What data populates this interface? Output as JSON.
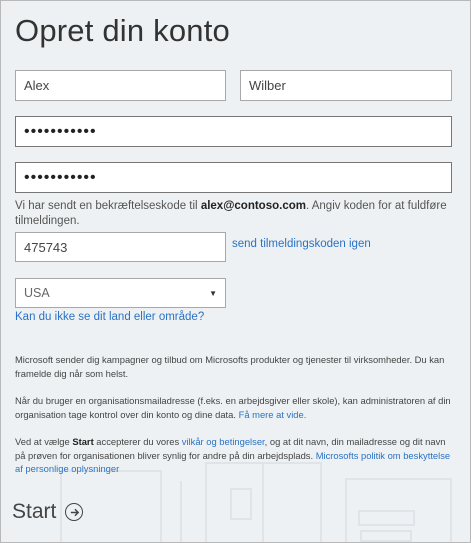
{
  "page": {
    "title": "Opret din konto"
  },
  "form": {
    "first_name": "Alex",
    "last_name": "Wilber",
    "password": "•••••••••••",
    "confirm_password": "•••••••••••",
    "info_prefix": "Vi har sendt en bekræftelseskode til ",
    "info_email": "alex@contoso.com",
    "info_suffix": ". Angiv koden for at fuldføre tilmeldingen.",
    "code": "475743",
    "resend_label": "send tilmeldingskoden igen",
    "country": "USA",
    "country_help": "Kan du ikke se dit land eller område?"
  },
  "legal": {
    "p1": "Microsoft sender dig kampagner og tilbud om Microsofts produkter og tjenester til virksomheder. Du kan framelde dig når som helst.",
    "p2_text": "Når du bruger en organisationsmailadresse (f.eks. en arbejdsgiver eller skole), kan administratoren af din organisation tage kontrol over din konto og dine data. ",
    "p2_link": "Få mere at vide.",
    "p3_a": "Ved at vælge ",
    "p3_bold": "Start",
    "p3_b": " accepterer du vores ",
    "p3_link1": "vilkår og betingelser",
    "p3_c": ", og at dit navn, din mailadresse og dit navn på prøven for organisationen bliver synlig for andre på din arbejdsplads. ",
    "p3_link2": "Microsofts politik om beskyttelse af personlige oplysninger"
  },
  "actions": {
    "start_label": "Start"
  },
  "colors": {
    "link": "#2a72c4",
    "background": "#eef1f3"
  }
}
